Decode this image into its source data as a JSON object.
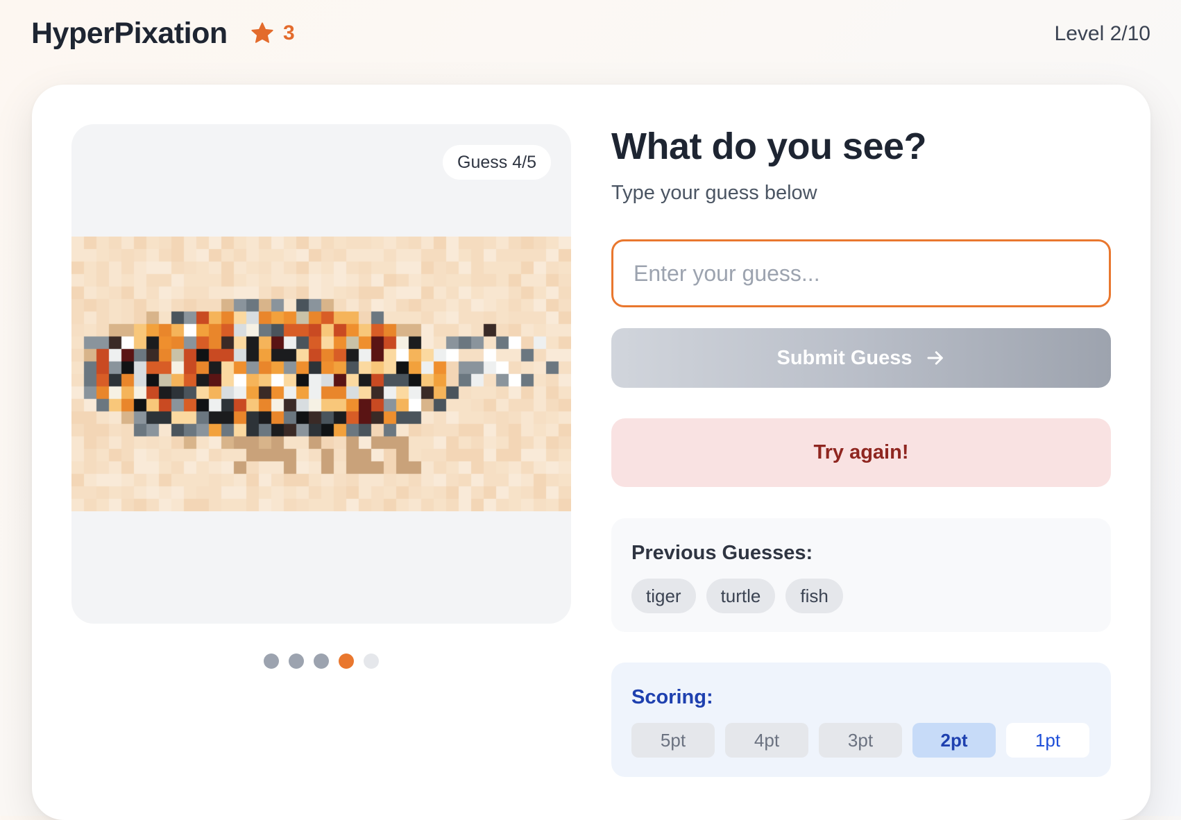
{
  "header": {
    "app_title": "HyperPixation",
    "star_count": "3",
    "level": "Level 2/10"
  },
  "game": {
    "guess_counter": "Guess 4/5",
    "current_guess_index": 4,
    "total_guesses": 5,
    "heading": "What do you see?",
    "subheading": "Type your guess below",
    "input_value": "",
    "input_placeholder": "Enter your guess...",
    "submit_label": "Submit Guess",
    "feedback": "Try again!"
  },
  "previous": {
    "title": "Previous Guesses:",
    "guesses": [
      "tiger",
      "turtle",
      "fish"
    ]
  },
  "scoring": {
    "title": "Scoring:",
    "points": [
      "5pt",
      "4pt",
      "3pt",
      "2pt",
      "1pt"
    ],
    "current_index": 3
  },
  "colors": {
    "accent": "#e9772e",
    "feedback_bg": "#f9e2e2",
    "feedback_text": "#8f2620",
    "scoring_text": "#1e40af"
  },
  "icons": {
    "star": "star-icon",
    "submit": "arrow-right-icon"
  }
}
